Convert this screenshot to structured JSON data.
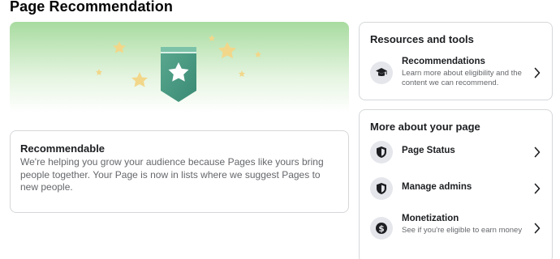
{
  "page": {
    "title": "Page Recommendation"
  },
  "recommendable": {
    "title": "Recommendable",
    "body": "We're helping you grow your audience because Pages like yours bring people together. Your Page is now in lists where we suggest Pages to new people."
  },
  "resources": {
    "heading": "Resources and tools",
    "items": [
      {
        "title": "Recommendations",
        "description": "Learn more about eligibility and the content we can recommend.",
        "icon": "graduation-cap-icon"
      }
    ]
  },
  "more": {
    "heading": "More about your page",
    "items": [
      {
        "title": "Page Status",
        "icon": "shield-icon"
      },
      {
        "title": "Manage admins",
        "icon": "shield-icon"
      },
      {
        "title": "Monetization",
        "description": "See if you're eligible to earn money",
        "icon": "dollar-icon"
      }
    ]
  },
  "colors": {
    "badge": "#4a9d82",
    "star": "#f2d78a",
    "hero_green": "#a8dba0",
    "border": "#d5d7da"
  }
}
